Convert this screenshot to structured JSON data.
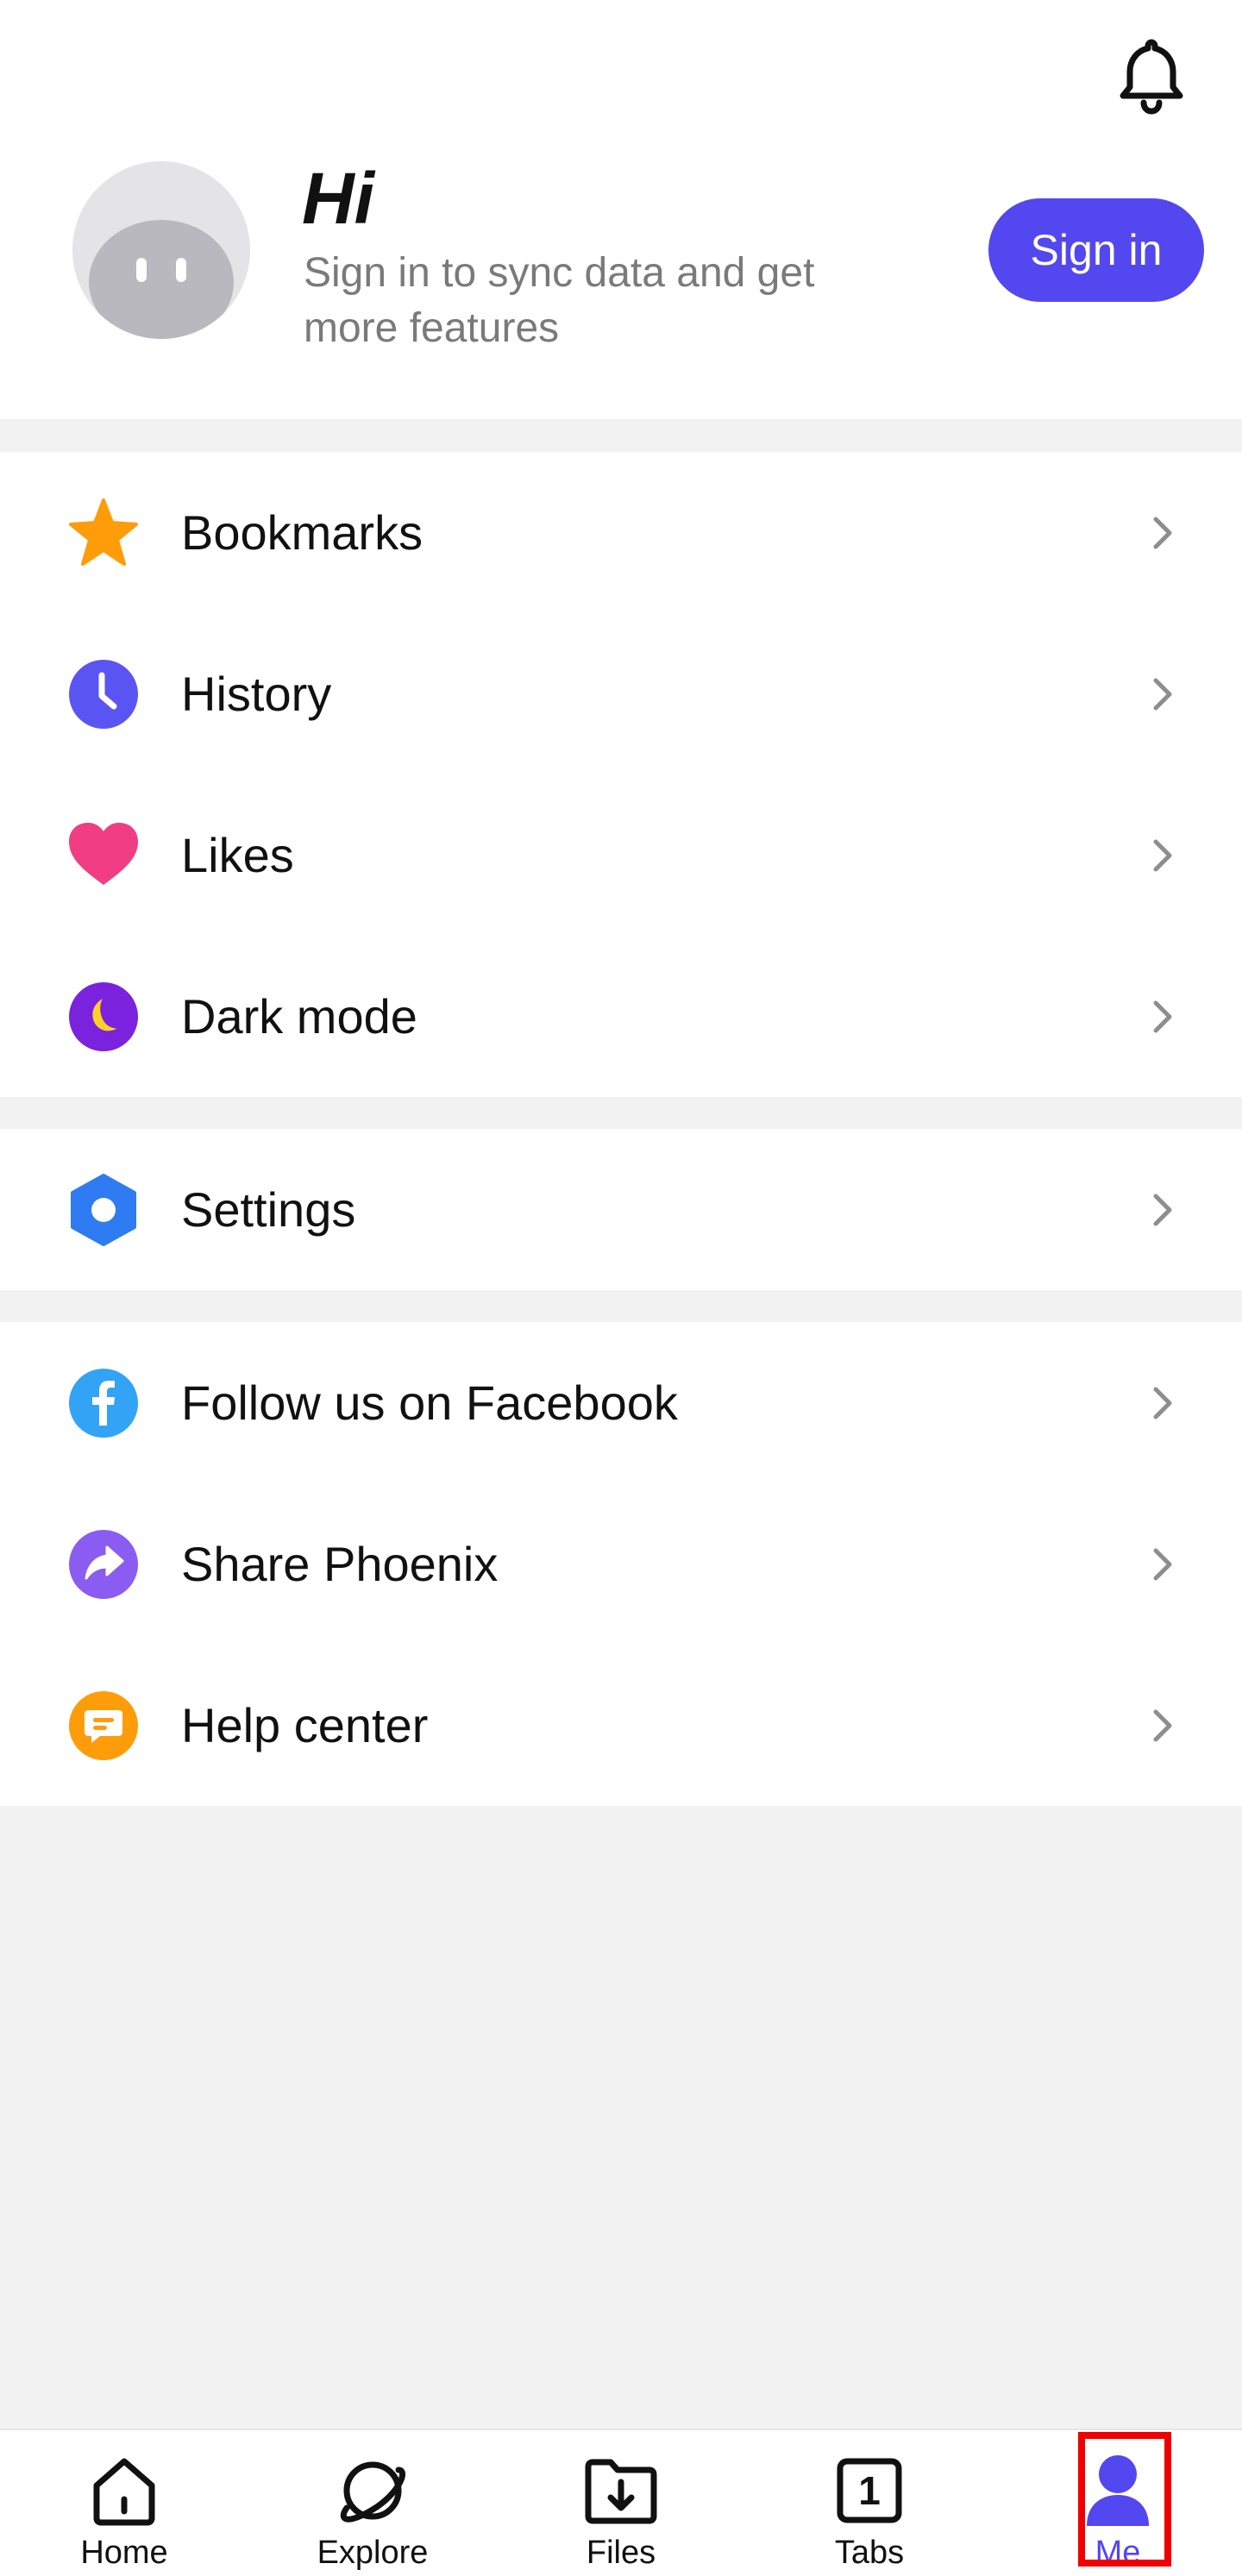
{
  "header": {
    "greeting": "Hi",
    "subtitle": "Sign in to sync data and get more features",
    "sign_in_label": "Sign in",
    "notification_icon": "bell-icon"
  },
  "menu_sections": [
    {
      "items": [
        {
          "label": "Bookmarks",
          "icon": "star-icon",
          "color": "#ff9c0a"
        },
        {
          "label": "History",
          "icon": "clock-icon",
          "color": "#5a55f2"
        },
        {
          "label": "Likes",
          "icon": "heart-icon",
          "color": "#f03d83"
        },
        {
          "label": "Dark mode",
          "icon": "moon-icon",
          "color": "#7a22dd"
        }
      ]
    },
    {
      "items": [
        {
          "label": "Settings",
          "icon": "gear-hexagon-icon",
          "color": "#2f7bf2"
        }
      ]
    },
    {
      "items": [
        {
          "label": "Follow us on Facebook",
          "icon": "facebook-icon",
          "color": "#33a3f5"
        },
        {
          "label": "Share Phoenix",
          "icon": "share-icon",
          "color": "#8a5cf2"
        },
        {
          "label": "Help center",
          "icon": "chat-bubble-icon",
          "color": "#ff9c0a"
        }
      ]
    }
  ],
  "bottom_nav": {
    "items": [
      {
        "label": "Home",
        "icon": "home-icon",
        "active": false
      },
      {
        "label": "Explore",
        "icon": "planet-icon",
        "active": false
      },
      {
        "label": "Files",
        "icon": "folder-download-icon",
        "active": false
      },
      {
        "label": "Tabs",
        "icon": "tabs-icon",
        "tab_count": "1",
        "active": false
      },
      {
        "label": "Me",
        "icon": "person-icon",
        "active": true
      }
    ]
  },
  "colors": {
    "accent": "#5347f0",
    "background": "#f2f2f2",
    "highlight": "#f00000"
  }
}
